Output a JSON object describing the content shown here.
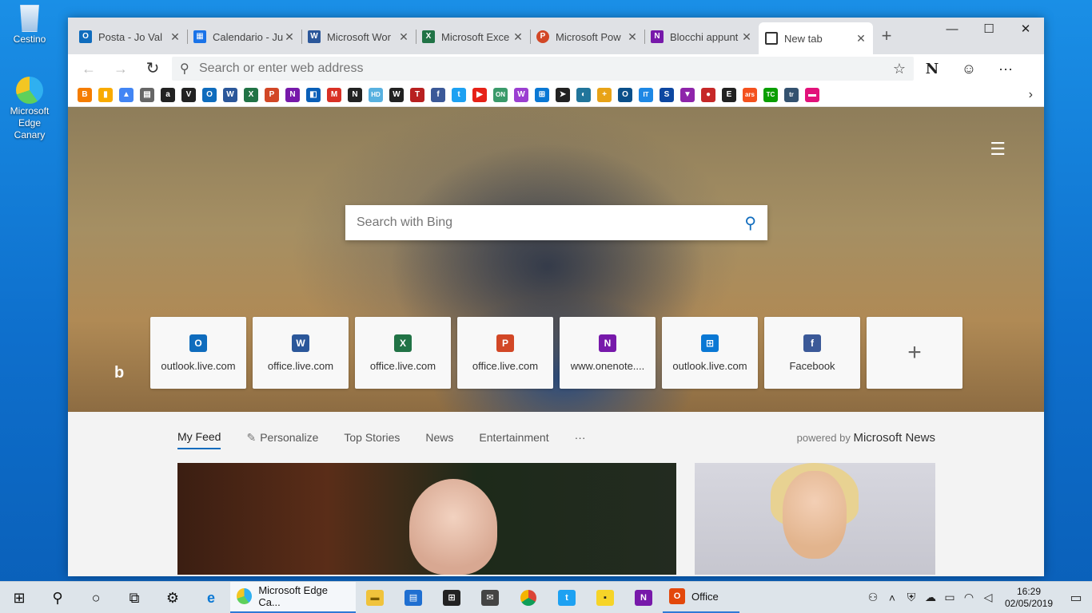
{
  "desktop": {
    "icons": [
      {
        "label": "Cestino"
      },
      {
        "label": "Microsoft Edge Canary"
      }
    ]
  },
  "browser": {
    "tabs": [
      {
        "label": "Posta - Jo Val",
        "icon": "outlook-icon",
        "color": "#0f6cbd",
        "glyph": "O"
      },
      {
        "label": "Calendario - Ju",
        "icon": "calendar-icon",
        "color": "#1a73e8",
        "glyph": "▦"
      },
      {
        "label": "Microsoft Wor",
        "icon": "word-icon",
        "color": "#2b579a",
        "glyph": "W"
      },
      {
        "label": "Microsoft Exce",
        "icon": "excel-icon",
        "color": "#217346",
        "glyph": "X"
      },
      {
        "label": "Microsoft Pow",
        "icon": "powerpoint-icon",
        "color": "#d24726",
        "glyph": "P"
      },
      {
        "label": "Blocchi appunt",
        "icon": "onenote-icon",
        "color": "#7719aa",
        "glyph": "N"
      },
      {
        "label": "New tab",
        "icon": "newtab-icon",
        "color": "#333333",
        "glyph": "▭"
      }
    ],
    "address": {
      "placeholder": "Search or enter web address"
    },
    "favorites": [
      {
        "icon": "blogger-icon",
        "color": "#f57d00",
        "glyph": "B"
      },
      {
        "icon": "analytics-icon",
        "color": "#f9ab00",
        "glyph": "▮"
      },
      {
        "icon": "drive-icon",
        "color": "#4285f4",
        "glyph": "▲"
      },
      {
        "icon": "store-icon",
        "color": "#666666",
        "glyph": "▤"
      },
      {
        "icon": "amazon-icon",
        "color": "#222222",
        "glyph": "a"
      },
      {
        "icon": "vimeo-icon",
        "color": "#222222",
        "glyph": "V"
      },
      {
        "icon": "outlook-icon",
        "color": "#0f6cbd",
        "glyph": "O"
      },
      {
        "icon": "word-icon",
        "color": "#2b579a",
        "glyph": "W"
      },
      {
        "icon": "excel-icon",
        "color": "#217346",
        "glyph": "X"
      },
      {
        "icon": "powerpoint-icon",
        "color": "#d24726",
        "glyph": "P"
      },
      {
        "icon": "onenote-icon",
        "color": "#7719aa",
        "glyph": "N"
      },
      {
        "icon": "office-icon",
        "color": "#0a5fb8",
        "glyph": "◧"
      },
      {
        "icon": "gmail-icon",
        "color": "#d93025",
        "glyph": "M"
      },
      {
        "icon": "n-icon",
        "color": "#222222",
        "glyph": "N"
      },
      {
        "icon": "hd-icon",
        "color": "#58b1e0",
        "glyph": "HD"
      },
      {
        "icon": "w-icon",
        "color": "#222222",
        "glyph": "W"
      },
      {
        "icon": "t-icon",
        "color": "#b82020",
        "glyph": "T"
      },
      {
        "icon": "facebook-icon",
        "color": "#3b5998",
        "glyph": "f"
      },
      {
        "icon": "twitter-icon",
        "color": "#1da1f2",
        "glyph": "t"
      },
      {
        "icon": "youtube-icon",
        "color": "#e62117",
        "glyph": "▶"
      },
      {
        "icon": "on-icon",
        "color": "#3a9a6a",
        "glyph": "ON"
      },
      {
        "icon": "wk-icon",
        "color": "#9b3fd1",
        "glyph": "W"
      },
      {
        "icon": "windows-icon",
        "color": "#0a78d4",
        "glyph": "⊞"
      },
      {
        "icon": "arrow-icon",
        "color": "#222222",
        "glyph": "➤"
      },
      {
        "icon": "wordpress-icon",
        "color": "#21759b",
        "glyph": "◐"
      },
      {
        "icon": "plus-color-icon",
        "color": "#e8a317",
        "glyph": "+"
      },
      {
        "icon": "o-icon",
        "color": "#0a4f8a",
        "glyph": "O"
      },
      {
        "icon": "itpro-icon",
        "color": "#1e88e5",
        "glyph": "IT"
      },
      {
        "icon": "s-icon",
        "color": "#0d47a1",
        "glyph": "S"
      },
      {
        "icon": "v-icon",
        "color": "#8e24aa",
        "glyph": "▼"
      },
      {
        "icon": "red-icon",
        "color": "#c62828",
        "glyph": "●"
      },
      {
        "icon": "e-icon",
        "color": "#212121",
        "glyph": "E"
      },
      {
        "icon": "ars-icon",
        "color": "#f4511e",
        "glyph": "ars"
      },
      {
        "icon": "tc-icon",
        "color": "#0a9e01",
        "glyph": "TC"
      },
      {
        "icon": "tr-icon",
        "color": "#34526f",
        "glyph": "tr"
      },
      {
        "icon": "theverge-icon",
        "color": "#e2127a",
        "glyph": "▬"
      }
    ]
  },
  "ntp": {
    "search_placeholder": "Search with Bing",
    "tiles": [
      {
        "label": "outlook.live.com",
        "icon": "outlook-icon",
        "color": "#0f6cbd",
        "glyph": "O"
      },
      {
        "label": "office.live.com",
        "icon": "word-icon",
        "color": "#2b579a",
        "glyph": "W"
      },
      {
        "label": "office.live.com",
        "icon": "excel-icon",
        "color": "#217346",
        "glyph": "X"
      },
      {
        "label": "office.live.com",
        "icon": "powerpoint-icon",
        "color": "#d24726",
        "glyph": "P"
      },
      {
        "label": "www.onenote....",
        "icon": "onenote-icon",
        "color": "#7719aa",
        "glyph": "N"
      },
      {
        "label": "outlook.live.com",
        "icon": "windows-icon",
        "color": "#0a78d4",
        "glyph": "⊞"
      },
      {
        "label": "Facebook",
        "icon": "facebook-icon",
        "color": "#3b5998",
        "glyph": "f"
      }
    ],
    "feed_tabs": [
      "My Feed",
      "Personalize",
      "Top Stories",
      "News",
      "Entertainment"
    ],
    "feed_more": "···",
    "powered_prefix": "powered by",
    "powered_brand": "Microsoft News"
  },
  "taskbar": {
    "edge_app_label": "Microsoft Edge Ca...",
    "office_label": "Office",
    "time": "16:29",
    "date": "02/05/2019"
  }
}
